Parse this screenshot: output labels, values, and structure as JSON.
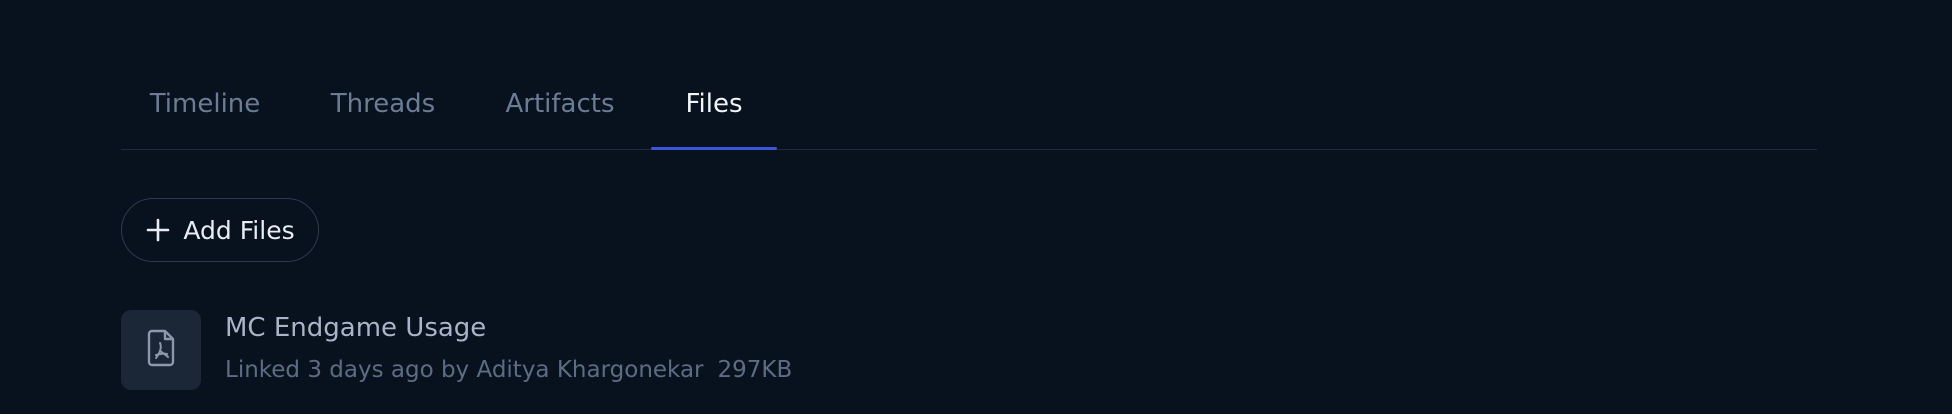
{
  "tabs": [
    {
      "label": "Timeline",
      "active": false
    },
    {
      "label": "Threads",
      "active": false
    },
    {
      "label": "Artifacts",
      "active": false
    },
    {
      "label": "Files",
      "active": true
    }
  ],
  "actions": {
    "add_files_label": "Add Files",
    "add_files_icon": "plus-icon"
  },
  "files": [
    {
      "name": "MC Endgame Usage",
      "meta": "Linked 3 days ago by Aditya Khargonekar",
      "size": "297KB",
      "icon": "pdf-file-icon"
    }
  ],
  "colors": {
    "background": "#08111e",
    "active_tab_indicator": "#3b56d6",
    "inactive_tab_text": "#6b7c94",
    "active_tab_text": "#f1f4f8"
  }
}
